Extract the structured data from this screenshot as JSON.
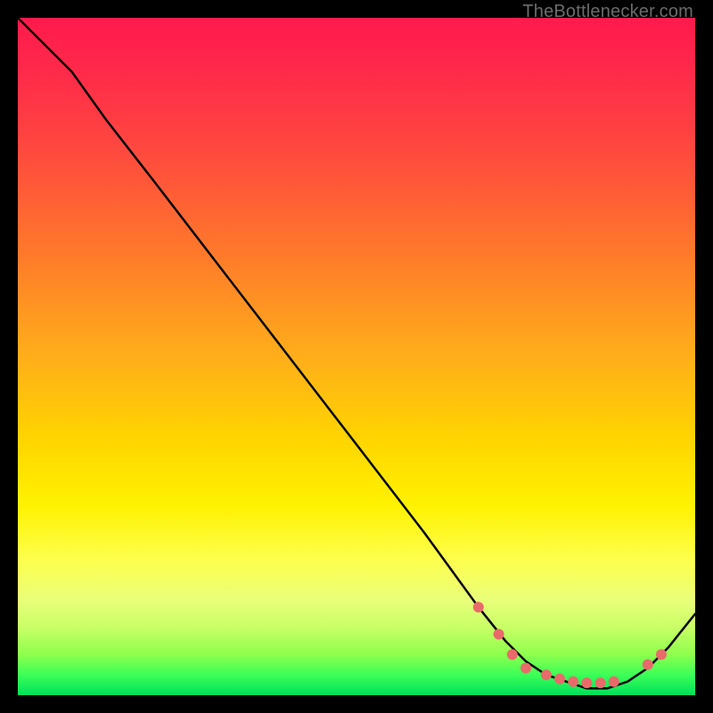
{
  "watermark": "TheBottlenecker.com",
  "chart_data": {
    "type": "line",
    "title": "",
    "xlabel": "",
    "ylabel": "",
    "xlim": [
      0,
      100
    ],
    "ylim": [
      0,
      100
    ],
    "grid": false,
    "series": [
      {
        "name": "curve",
        "x": [
          0,
          8,
          13,
          20,
          30,
          40,
          50,
          60,
          68,
          72,
          75,
          78,
          81,
          84,
          87,
          90,
          93,
          96,
          100
        ],
        "y": [
          100,
          92,
          85,
          76,
          63,
          50,
          37,
          24,
          13,
          8,
          5,
          3,
          2,
          1,
          1,
          2,
          4,
          7,
          12
        ]
      }
    ],
    "markers": {
      "name": "highlight-dots",
      "color": "#e96a6a",
      "x": [
        68,
        71,
        73,
        75,
        78,
        80,
        82,
        84,
        86,
        88,
        93,
        95
      ],
      "y": [
        13,
        9,
        6,
        4,
        3,
        2.4,
        2,
        1.8,
        1.8,
        2,
        4.5,
        6
      ]
    },
    "background_gradient": [
      "#ff1a4d",
      "#ff7a2a",
      "#ffd400",
      "#fdff4d",
      "#8eff4d",
      "#00e05a"
    ]
  }
}
